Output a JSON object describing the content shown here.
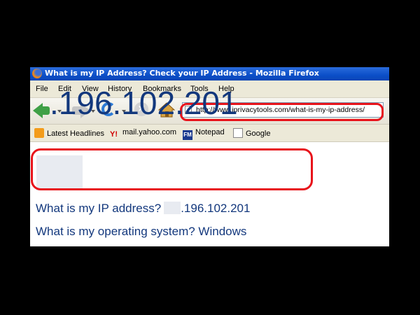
{
  "window": {
    "title": "What is my IP Address? Check your IP Address - Mozilla Firefox"
  },
  "menubar": {
    "items": [
      "File",
      "Edit",
      "View",
      "History",
      "Bookmarks",
      "Tools",
      "Help"
    ]
  },
  "navbar": {
    "url": "http://www.iprivacytools.com/what-is-my-ip-address/"
  },
  "bookmarks": {
    "items": [
      {
        "label": "Latest Headlines",
        "icon": "rss-icon"
      },
      {
        "label": "mail.yahoo.com",
        "icon": "yahoo-icon"
      },
      {
        "label": "Notepad",
        "icon": "fm-icon"
      },
      {
        "label": "Google",
        "icon": "page-icon"
      }
    ]
  },
  "content": {
    "big_ip": ".196.102.201",
    "ip_question": "What is my IP address?",
    "ip_value": ".196.102.201",
    "os_line": "What is my operating system? Windows"
  },
  "colors": {
    "titlebar": "#0b4fc8",
    "content_text": "#13387d",
    "highlight": "#e8141b",
    "background": "#000000"
  }
}
